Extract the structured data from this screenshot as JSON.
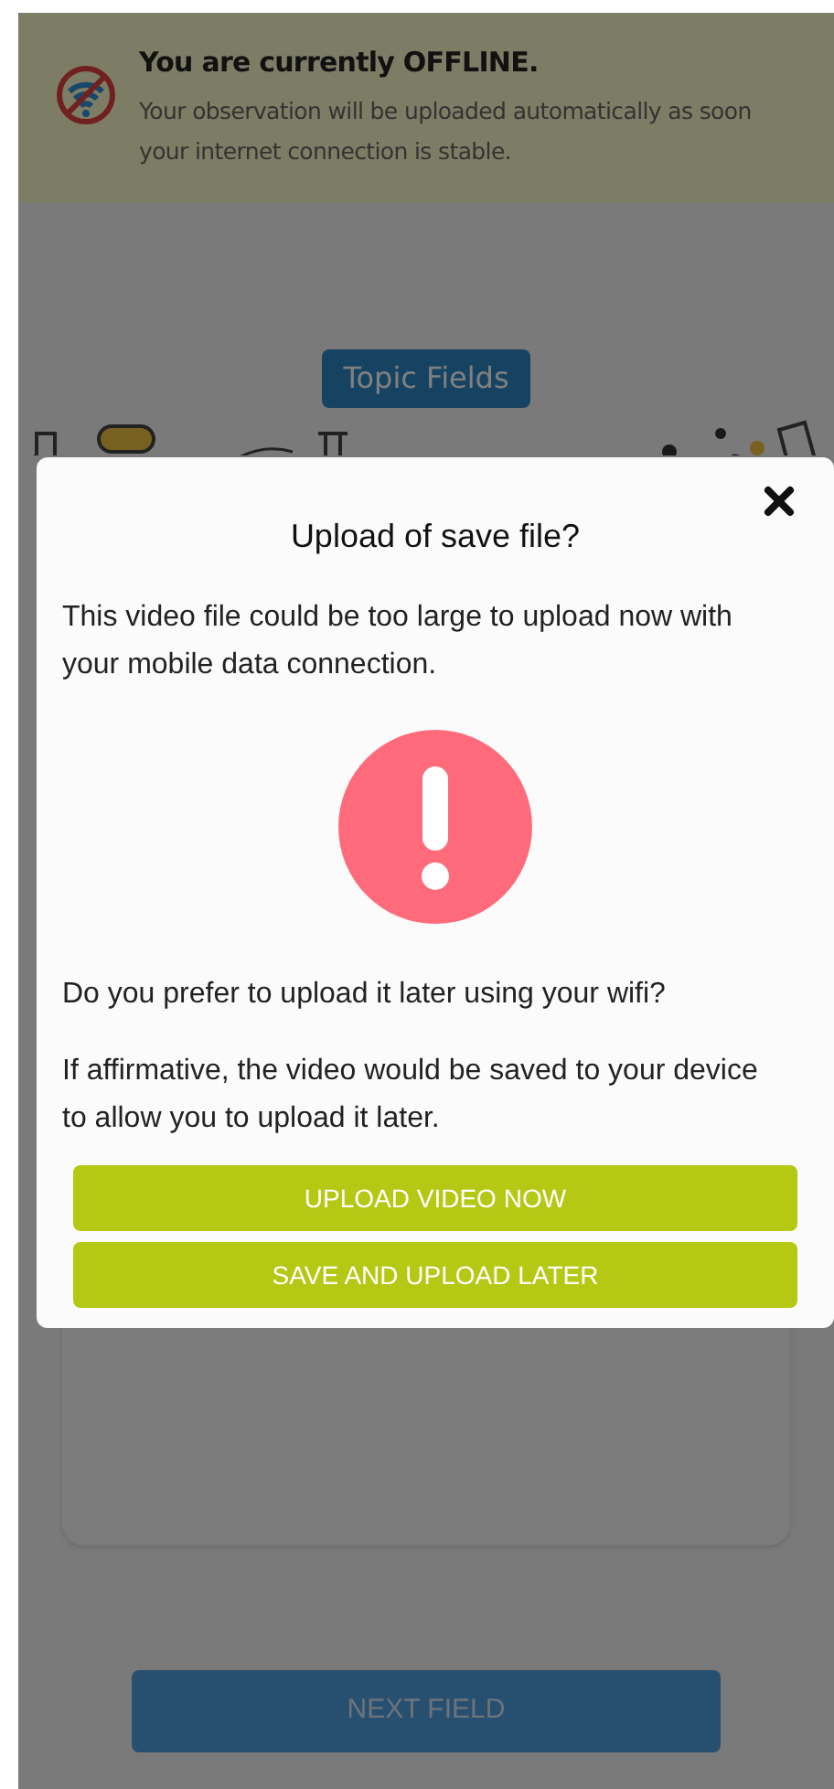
{
  "offline_banner": {
    "title": "You are currently OFFLINE.",
    "message": "Your observation will be uploaded automatically as soon your internet connection is stable."
  },
  "topic_label": "Topic Fields",
  "next_button": "NEXT FIELD",
  "dialog": {
    "title": "Upload of save file?",
    "intro": "This video file could be too large to upload now with your mobile data connection.",
    "question": "Do you prefer to upload it later using your wifi?",
    "note": "If affirmative, the video would be saved to your device to allow you to upload it later.",
    "buttons": [
      "UPLOAD VIDEO NOW",
      "SAVE AND UPLOAD LATER"
    ]
  }
}
